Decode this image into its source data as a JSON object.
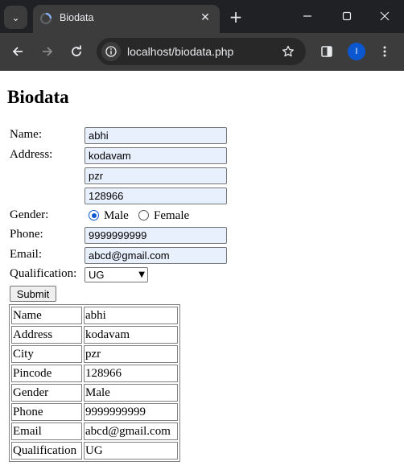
{
  "browser": {
    "tab_title": "Biodata",
    "url": "localhost/biodata.php",
    "profile_initial": "I"
  },
  "page": {
    "heading": "Biodata",
    "form": {
      "name_label": "Name:",
      "name_value": "abhi",
      "address_label": "Address:",
      "address_line1": "kodavam",
      "address_line2": "pzr",
      "address_line3": "128966",
      "gender_label": "Gender:",
      "gender_options": [
        "Male",
        "Female"
      ],
      "gender_selected": "Male",
      "phone_label": "Phone:",
      "phone_value": "9999999999",
      "email_label": "Email:",
      "email_value": "abcd@gmail.com",
      "qualification_label": "Qualification:",
      "qualification_value": "UG",
      "submit_label": "Submit"
    },
    "result_table": [
      {
        "key": "Name",
        "value": "abhi"
      },
      {
        "key": "Address",
        "value": "kodavam"
      },
      {
        "key": "City",
        "value": "pzr"
      },
      {
        "key": "Pincode",
        "value": "128966"
      },
      {
        "key": "Gender",
        "value": "Male"
      },
      {
        "key": "Phone",
        "value": "9999999999"
      },
      {
        "key": "Email",
        "value": "abcd@gmail.com"
      },
      {
        "key": "Qualification",
        "value": "UG"
      }
    ]
  },
  "colors": {
    "autofill_bg": "#e8f0fe",
    "radio_accent": "#0b57d0",
    "chrome_dark": "#202124",
    "toolbar": "#3c3c3c"
  }
}
